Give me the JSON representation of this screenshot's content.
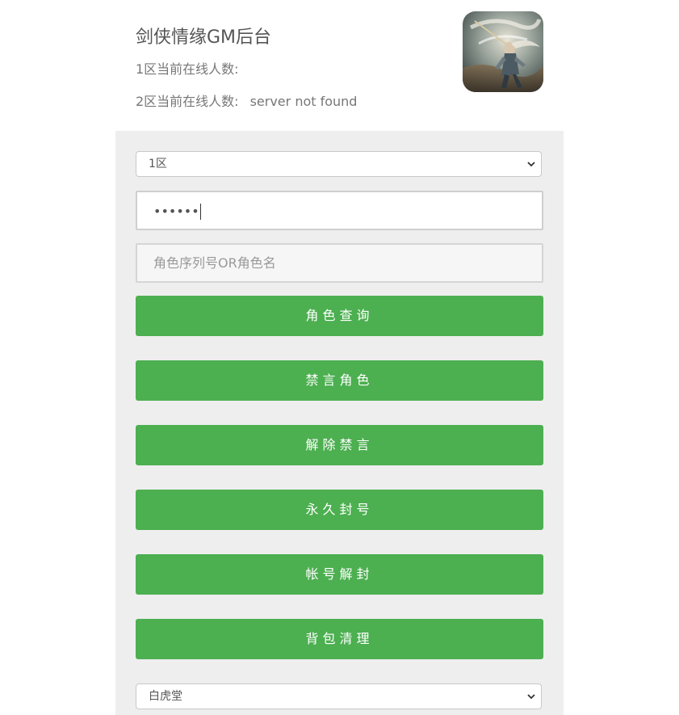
{
  "header": {
    "title": "剑侠情缘GM后台",
    "zone1_label": "1区当前在线人数:",
    "zone1_value": "",
    "zone2_label": "2区当前在线人数:",
    "zone2_value": "server not found"
  },
  "form": {
    "zone_select": {
      "selected": "1区"
    },
    "password": {
      "value": "••••••"
    },
    "role_input": {
      "placeholder": "角色序列号OR角色名",
      "value": ""
    },
    "hall_select": {
      "selected": "白虎堂"
    }
  },
  "buttons": {
    "query_role": "角色查询",
    "mute_role": "禁言角色",
    "unmute": "解除禁言",
    "permanent_ban": "永久封号",
    "unban_account": "帐号解封",
    "clear_bag": "背包清理"
  },
  "colors": {
    "button_bg": "#4caf50",
    "panel_bg": "#eeeeee"
  },
  "icons": {
    "game_avatar": "game-character-avatar",
    "dropdown": "chevron-down-icon"
  }
}
